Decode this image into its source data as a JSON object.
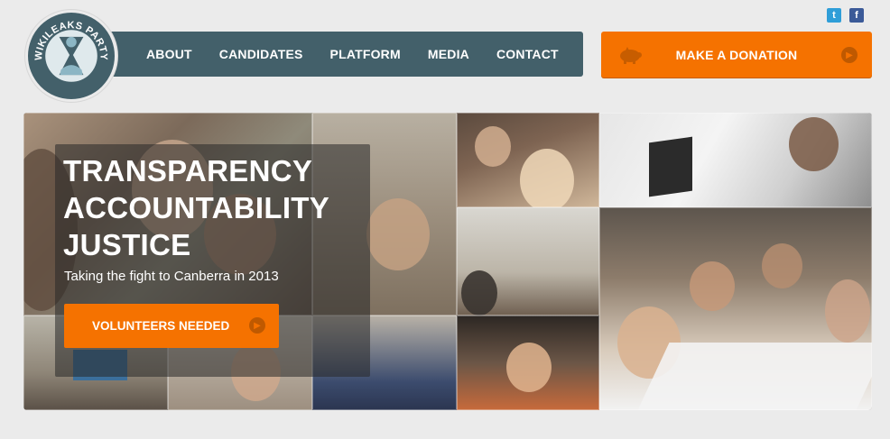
{
  "social": {
    "twitter_icon": "twitter-icon",
    "facebook_icon": "facebook-icon"
  },
  "logo": {
    "text": "WIKILEAKS PARTY"
  },
  "nav": {
    "items": [
      {
        "label": "ABOUT"
      },
      {
        "label": "CANDIDATES"
      },
      {
        "label": "PLATFORM"
      },
      {
        "label": "MEDIA"
      },
      {
        "label": "CONTACT"
      }
    ]
  },
  "donate": {
    "label": "MAKE A DONATION",
    "icon": "piggy-bank-icon"
  },
  "hero": {
    "title_lines": [
      "TRANSPARENCY",
      "ACCOUNTABILITY",
      "JUSTICE"
    ],
    "subtitle": "Taking the fight to Canberra in 2013",
    "cta_label": "VOLUNTEERS NEEDED"
  },
  "colors": {
    "nav_bg": "#43606a",
    "accent": "#f57200",
    "page_bg": "#ebebeb"
  }
}
